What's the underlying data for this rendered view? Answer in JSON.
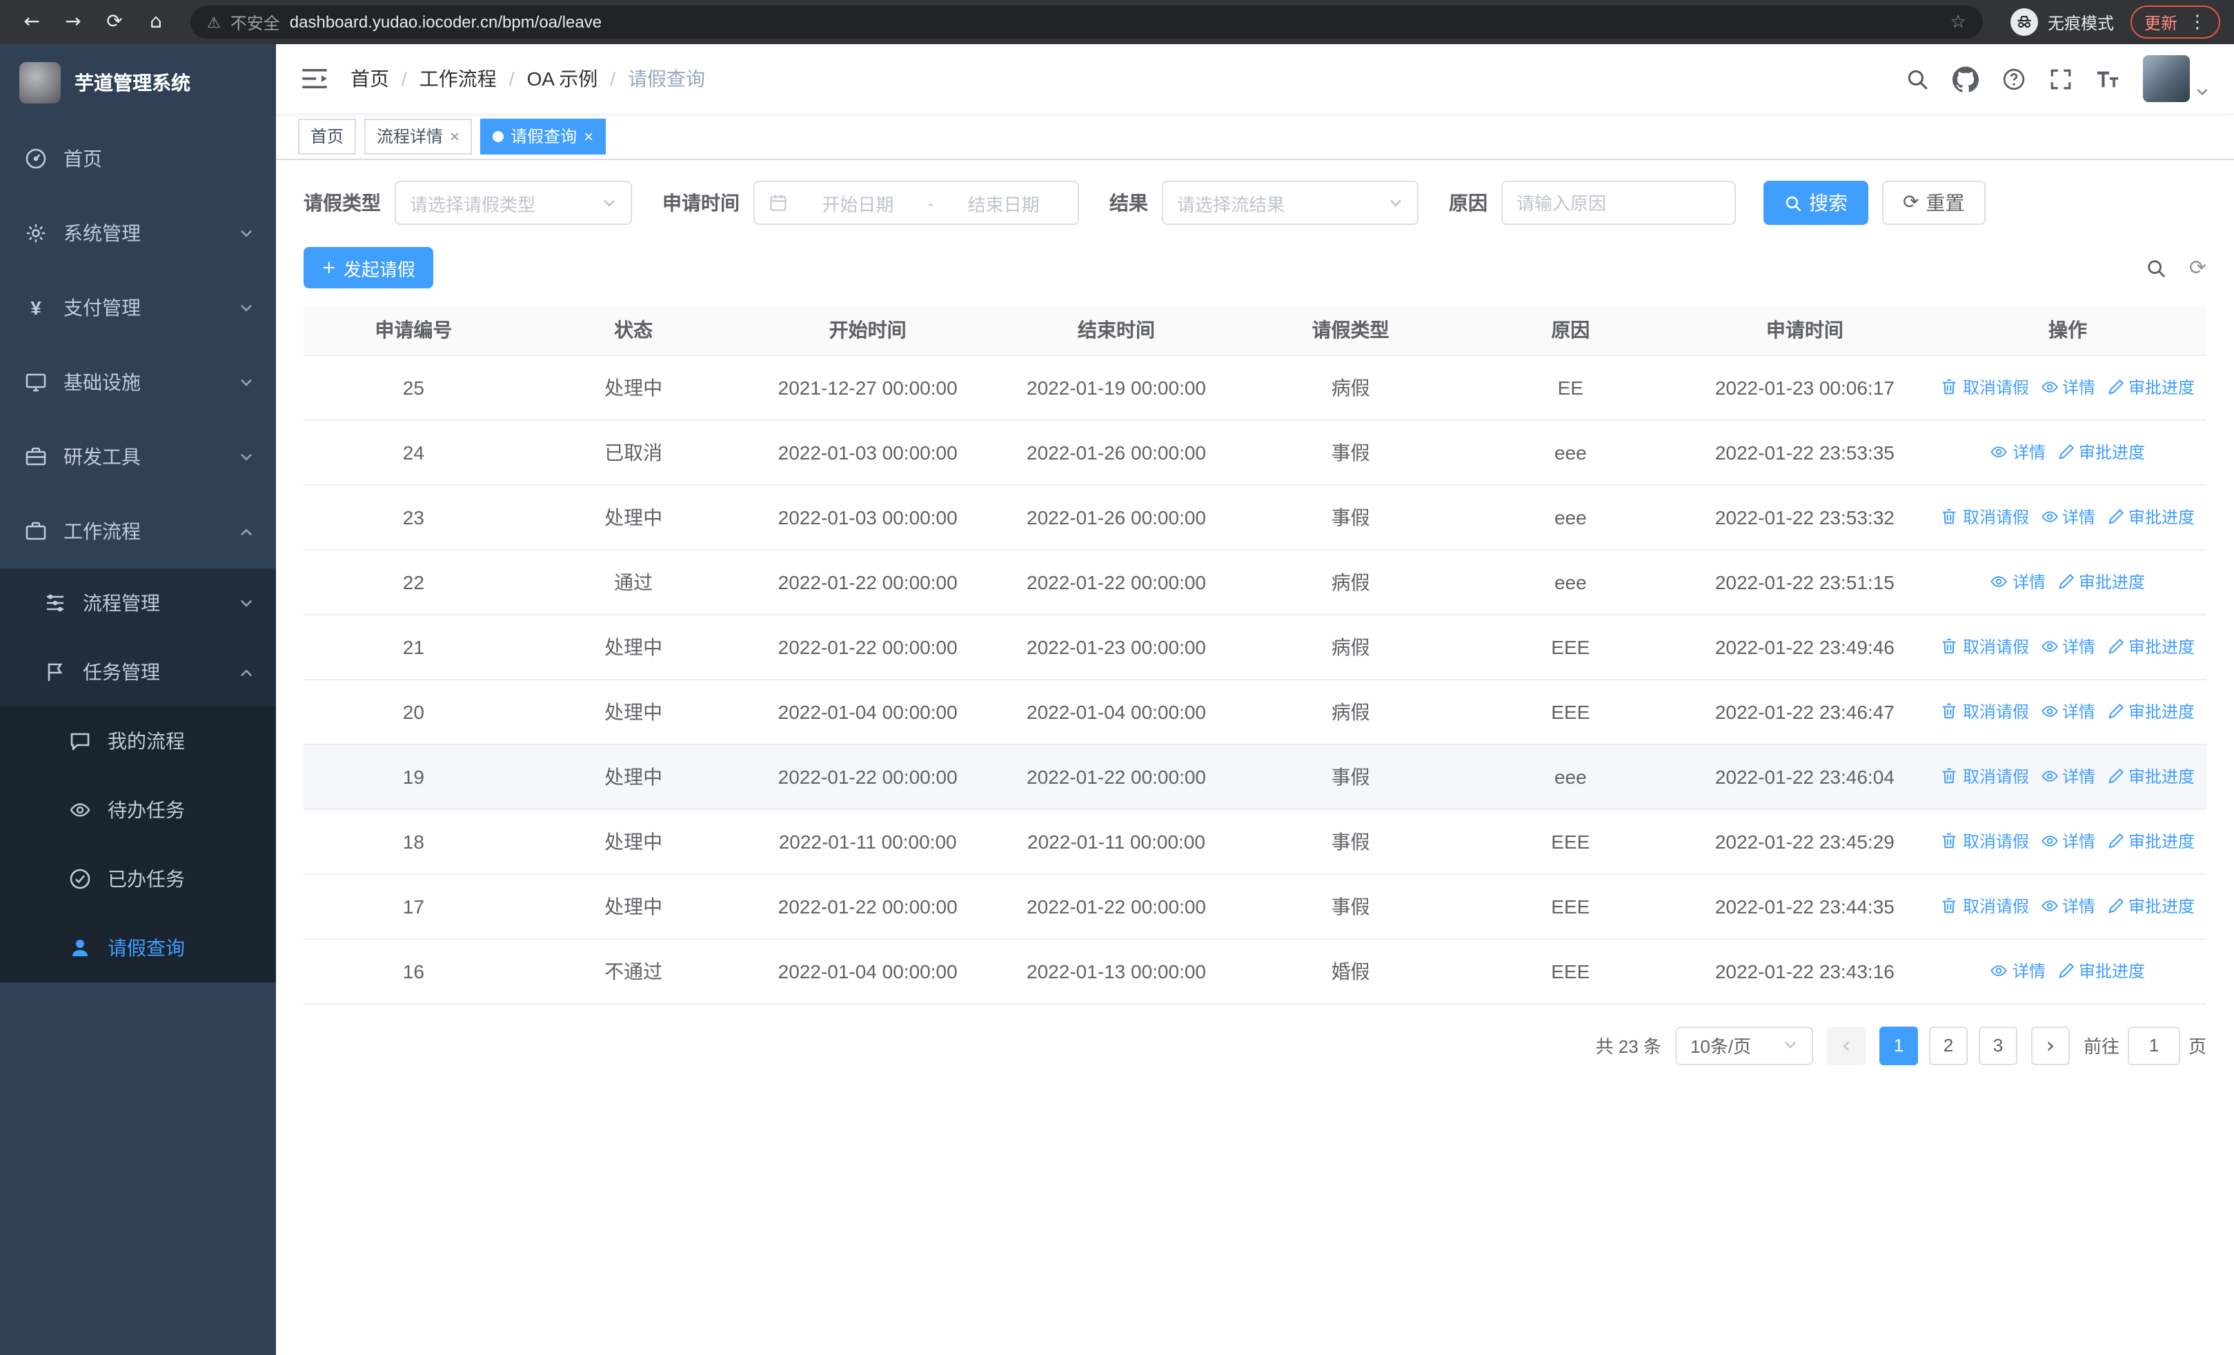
{
  "browser": {
    "security_label": "不安全",
    "url": "dashboard.yudao.iocoder.cn/bpm/oa/leave",
    "incognito_label": "无痕模式",
    "update_label": "更新"
  },
  "icons": {
    "back": "←",
    "forward": "→",
    "reload": "⟳",
    "home": "⌂",
    "warning": "⚠",
    "star": "☆",
    "kebab": "⋮",
    "close": "×",
    "plus": "+",
    "prev": "‹",
    "next": "›",
    "reset": "⟳",
    "refresh": "⟳"
  },
  "sidebar": {
    "app_title": "芋道管理系统",
    "items": [
      {
        "label": "首页"
      },
      {
        "label": "系统管理"
      },
      {
        "label": "支付管理"
      },
      {
        "label": "基础设施"
      },
      {
        "label": "研发工具"
      },
      {
        "label": "工作流程"
      }
    ],
    "process_group": {
      "label": "流程管理"
    },
    "task_group": {
      "label": "任务管理"
    },
    "task_items": [
      {
        "label": "我的流程"
      },
      {
        "label": "待办任务"
      },
      {
        "label": "已办任务"
      },
      {
        "label": "请假查询"
      }
    ]
  },
  "header": {
    "breadcrumb": [
      "首页",
      "工作流程",
      "OA 示例",
      "请假查询"
    ]
  },
  "tabs": [
    {
      "label": "首页"
    },
    {
      "label": "流程详情"
    },
    {
      "label": "请假查询"
    }
  ],
  "filters": {
    "leave_type_label": "请假类型",
    "leave_type_placeholder": "请选择请假类型",
    "apply_time_label": "申请时间",
    "start_date_placeholder": "开始日期",
    "range_separator": "-",
    "end_date_placeholder": "结束日期",
    "result_label": "结果",
    "result_placeholder": "请选择流结果",
    "reason_label": "原因",
    "reason_placeholder": "请输入原因",
    "search_button": "搜索",
    "reset_button": "重置"
  },
  "toolbar": {
    "create_button": "发起请假"
  },
  "table": {
    "columns": [
      "申请编号",
      "状态",
      "开始时间",
      "结束时间",
      "请假类型",
      "原因",
      "申请时间",
      "操作"
    ],
    "op_labels": {
      "cancel": "取消请假",
      "detail": "详情",
      "progress": "审批进度"
    },
    "rows": [
      {
        "id": "25",
        "status": "处理中",
        "start": "2021-12-27 00:00:00",
        "end": "2022-01-19 00:00:00",
        "type": "病假",
        "reason": "EE",
        "applied": "2022-01-23 00:06:17",
        "ops": [
          "cancel",
          "detail",
          "progress"
        ]
      },
      {
        "id": "24",
        "status": "已取消",
        "start": "2022-01-03 00:00:00",
        "end": "2022-01-26 00:00:00",
        "type": "事假",
        "reason": "eee",
        "applied": "2022-01-22 23:53:35",
        "ops": [
          "detail",
          "progress"
        ]
      },
      {
        "id": "23",
        "status": "处理中",
        "start": "2022-01-03 00:00:00",
        "end": "2022-01-26 00:00:00",
        "type": "事假",
        "reason": "eee",
        "applied": "2022-01-22 23:53:32",
        "ops": [
          "cancel",
          "detail",
          "progress"
        ]
      },
      {
        "id": "22",
        "status": "通过",
        "start": "2022-01-22 00:00:00",
        "end": "2022-01-22 00:00:00",
        "type": "病假",
        "reason": "eee",
        "applied": "2022-01-22 23:51:15",
        "ops": [
          "detail",
          "progress"
        ]
      },
      {
        "id": "21",
        "status": "处理中",
        "start": "2022-01-22 00:00:00",
        "end": "2022-01-23 00:00:00",
        "type": "病假",
        "reason": "EEE",
        "applied": "2022-01-22 23:49:46",
        "ops": [
          "cancel",
          "detail",
          "progress"
        ]
      },
      {
        "id": "20",
        "status": "处理中",
        "start": "2022-01-04 00:00:00",
        "end": "2022-01-04 00:00:00",
        "type": "病假",
        "reason": "EEE",
        "applied": "2022-01-22 23:46:47",
        "ops": [
          "cancel",
          "detail",
          "progress"
        ]
      },
      {
        "id": "19",
        "status": "处理中",
        "start": "2022-01-22 00:00:00",
        "end": "2022-01-22 00:00:00",
        "type": "事假",
        "reason": "eee",
        "applied": "2022-01-22 23:46:04",
        "ops": [
          "cancel",
          "detail",
          "progress"
        ],
        "hover": true
      },
      {
        "id": "18",
        "status": "处理中",
        "start": "2022-01-11 00:00:00",
        "end": "2022-01-11 00:00:00",
        "type": "事假",
        "reason": "EEE",
        "applied": "2022-01-22 23:45:29",
        "ops": [
          "cancel",
          "detail",
          "progress"
        ]
      },
      {
        "id": "17",
        "status": "处理中",
        "start": "2022-01-22 00:00:00",
        "end": "2022-01-22 00:00:00",
        "type": "事假",
        "reason": "EEE",
        "applied": "2022-01-22 23:44:35",
        "ops": [
          "cancel",
          "detail",
          "progress"
        ]
      },
      {
        "id": "16",
        "status": "不通过",
        "start": "2022-01-04 00:00:00",
        "end": "2022-01-13 00:00:00",
        "type": "婚假",
        "reason": "EEE",
        "applied": "2022-01-22 23:43:16",
        "ops": [
          "detail",
          "progress"
        ]
      }
    ]
  },
  "pagination": {
    "total_text": "共 23 条",
    "page_size": "10条/页",
    "pages": [
      "1",
      "2",
      "3"
    ],
    "active_page": "1",
    "goto_label": "前往",
    "goto_value": "1",
    "goto_suffix": "页"
  },
  "colors": {
    "primary": "#409eff",
    "sidebar_bg": "#304156",
    "sidebar_sub_bg": "#1f2d3d",
    "update_red": "#e25544"
  }
}
